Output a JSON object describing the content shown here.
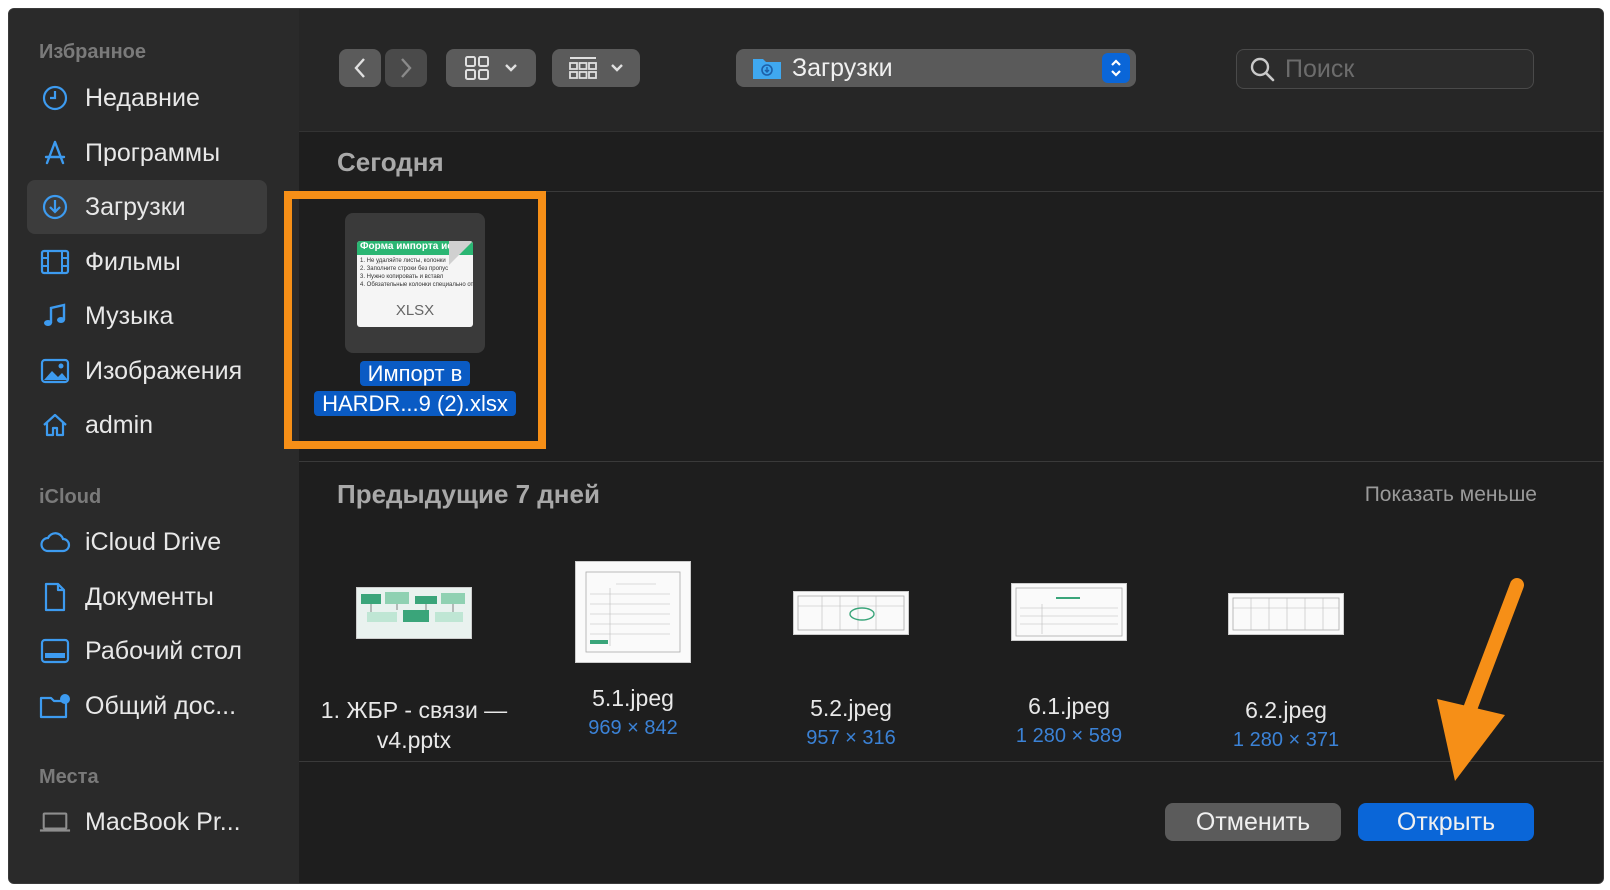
{
  "sidebar": {
    "favorites_title": "Избранное",
    "favorites": [
      {
        "label": "Недавние",
        "icon": "clock-icon"
      },
      {
        "label": "Программы",
        "icon": "apps-icon"
      },
      {
        "label": "Загрузки",
        "icon": "download-icon",
        "active": true
      },
      {
        "label": "Фильмы",
        "icon": "film-icon"
      },
      {
        "label": "Музыка",
        "icon": "music-icon"
      },
      {
        "label": "Изображения",
        "icon": "image-icon"
      },
      {
        "label": "admin",
        "icon": "home-icon"
      }
    ],
    "icloud_title": "iCloud",
    "icloud": [
      {
        "label": "iCloud Drive",
        "icon": "cloud-icon"
      },
      {
        "label": "Документы",
        "icon": "document-icon"
      },
      {
        "label": "Рабочий стол",
        "icon": "desktop-icon"
      },
      {
        "label": "Общий дос...",
        "icon": "shared-folder-icon"
      }
    ],
    "places_title": "Места",
    "places": [
      {
        "label": "MacBook Pr...",
        "icon": "laptop-icon"
      }
    ]
  },
  "toolbar": {
    "location": "Загрузки",
    "search_placeholder": "Поиск"
  },
  "groups": {
    "today": "Сегодня",
    "previous": "Предыдущие 7 дней",
    "show_less": "Показать меньше"
  },
  "selected_file": {
    "name_line1": "Импорт в",
    "name_line2": "HARDR...9 (2).xlsx",
    "ext": "XLSX",
    "preview_header": "Форма импорта исх",
    "preview_lines": [
      "1. Не удаляйте листы, колонки",
      "2. Заполните строки без пропус",
      "3. Нужно копировать и вставл",
      "4. Обязательные колонки специально от"
    ]
  },
  "files": [
    {
      "name_line1": "1. ЖБР - связи —",
      "name_line2": "v4.pptx",
      "dims": ""
    },
    {
      "name_line1": "5.1.jpeg",
      "name_line2": "",
      "dims": "969 × 842"
    },
    {
      "name_line1": "5.2.jpeg",
      "name_line2": "",
      "dims": "957 × 316"
    },
    {
      "name_line1": "6.1.jpeg",
      "name_line2": "",
      "dims": "1 280 × 589"
    },
    {
      "name_line1": "6.2.jpeg",
      "name_line2": "",
      "dims": "1 280 × 371"
    }
  ],
  "buttons": {
    "cancel": "Отменить",
    "open": "Открыть"
  },
  "colors": {
    "accent": "#0a66d8",
    "highlight": "#f68f17"
  }
}
